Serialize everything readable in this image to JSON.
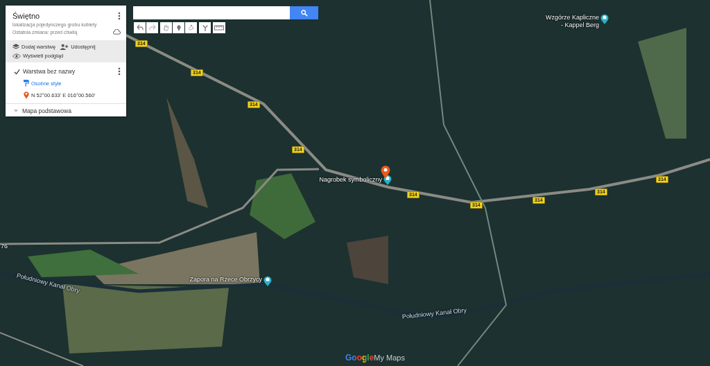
{
  "panel": {
    "title": "Świętno",
    "description": "lokalizacja pojedynczego grobu kobiety",
    "last_change": "Ostatnia zmiana: przed chwilą",
    "actions": [
      {
        "kind": "add_layer",
        "label": "Dodaj warstwę"
      },
      {
        "kind": "share",
        "label": "Udostępnij"
      },
      {
        "kind": "preview",
        "label": "Wyświetl podgląd"
      }
    ],
    "layer": {
      "name": "Warstwa bez nazwy",
      "checked": true,
      "style_link": "Osobne style",
      "items": [
        {
          "label": "N 52°00.633' E 016°00.560'"
        }
      ]
    },
    "base_map": {
      "label": "Mapa podstawowa",
      "expanded": false
    }
  },
  "map": {
    "road_shields": [
      "314",
      "314",
      "314",
      "314",
      "314",
      "314",
      "314",
      "314",
      "314"
    ],
    "labels": [
      {
        "kind": "poi",
        "text": "Wzgórze Kapliczne\n- Kappel Berg"
      },
      {
        "kind": "poi",
        "text": "Nagrobek symboliczny"
      },
      {
        "kind": "poi",
        "text": "Zapora na Rzece Obrzycy"
      },
      {
        "kind": "water",
        "text": "Południowy Kanał Obry"
      },
      {
        "kind": "water",
        "text": "Południowy Kanał Obry"
      },
      {
        "kind": "road",
        "text": "76"
      }
    ]
  },
  "logo": {
    "brand": "Google",
    "product": "My Maps"
  }
}
